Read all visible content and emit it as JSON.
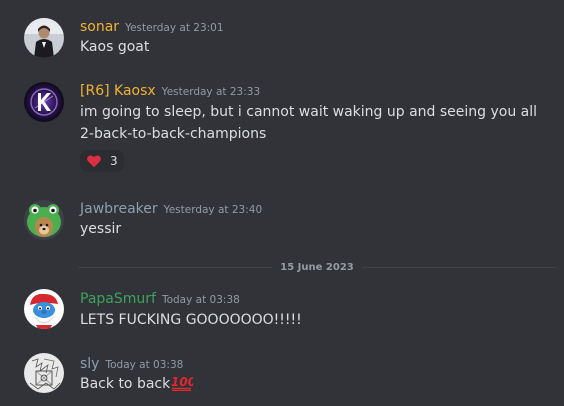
{
  "messages": [
    {
      "username": "sonar",
      "username_color": "#f0b232",
      "timestamp": "Yesterday at 23:01",
      "content": "Kaos goat",
      "avatar_icon": "user-avatar-icon"
    },
    {
      "username": "[R6] Kaosx",
      "username_color": "#f0b232",
      "timestamp": "Yesterday at 23:33",
      "content_line1": "im going to sleep, but i cannot wait waking up and seeing you all",
      "content_line2": "2-back-to-back-champions",
      "reaction": {
        "emoji": "heart-icon",
        "count": "3"
      },
      "avatar_icon": "kaosx-logo-avatar-icon"
    },
    {
      "username": "Jawbreaker",
      "username_color": "#8c9fb0",
      "timestamp": "Yesterday at 23:40",
      "content": "yessir",
      "avatar_icon": "frog-hat-dog-avatar-icon"
    },
    {
      "username": "PapaSmurf",
      "username_color": "#3ba55c",
      "timestamp": "Today at 03:38",
      "content": "LETS FUCKING GOOOOOOO!!!!!",
      "avatar_icon": "smurf-avatar-icon"
    },
    {
      "username": "sly",
      "username_color": "#8c9fb0",
      "timestamp": "Today at 03:38",
      "content": "Back to back",
      "emoji": "hundred-points-icon",
      "avatar_icon": "sketch-avatar-icon"
    }
  ],
  "date_divider": "15 June 2023",
  "colors": {
    "background": "#313338",
    "text": "#dbdee1",
    "muted": "#949ba4",
    "reaction_bg": "#2b2d31",
    "heart": "#dd2e44",
    "hundred": "#e5262f"
  }
}
